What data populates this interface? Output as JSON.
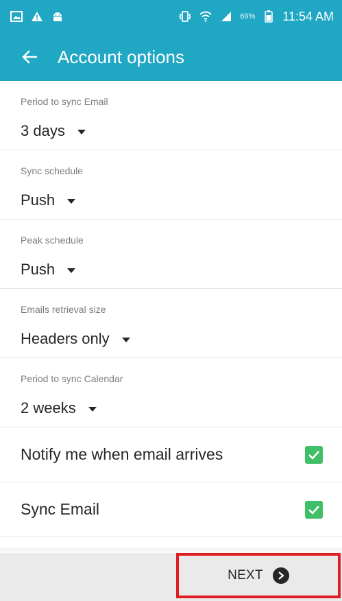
{
  "status_bar": {
    "battery_percent": "69%",
    "time": "11:54 AM",
    "icons": [
      "gallery-icon",
      "warning-icon",
      "android-icon",
      "vibrate-icon",
      "wifi-icon",
      "signal-icon",
      "battery-icon"
    ]
  },
  "app_bar": {
    "title": "Account options",
    "back_icon": "arrow-left-icon",
    "color": "#1fa7c4"
  },
  "settings": [
    {
      "label": "Period to sync Email",
      "value": "3 days"
    },
    {
      "label": "Sync schedule",
      "value": "Push"
    },
    {
      "label": "Peak schedule",
      "value": "Push"
    },
    {
      "label": "Emails retrieval size",
      "value": "Headers only"
    },
    {
      "label": "Period to sync Calendar",
      "value": "2 weeks"
    }
  ],
  "toggles": [
    {
      "label": "Notify me when email arrives",
      "checked": true
    },
    {
      "label": "Sync Email",
      "checked": true
    }
  ],
  "footer": {
    "next_label": "NEXT",
    "highlight_color": "#e11d24",
    "checkbox_color": "#3fbf67"
  }
}
